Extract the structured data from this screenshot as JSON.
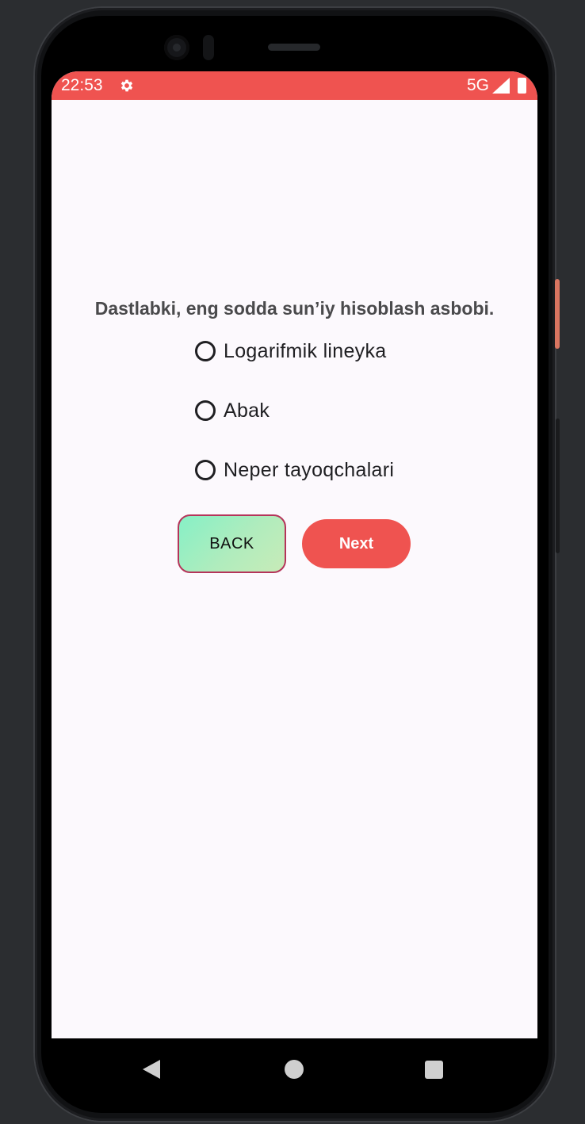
{
  "status_bar": {
    "time": "22:53",
    "network": "5G",
    "background_color": "#ef5350",
    "icons": [
      "gear-icon",
      "signal-icon",
      "battery-icon"
    ]
  },
  "quiz": {
    "question": "Dastlabki, eng sodda sun’iy hisoblash asbobi.",
    "options": [
      {
        "label": "Logarifmik lineyka",
        "selected": false
      },
      {
        "label": "Abak",
        "selected": false
      },
      {
        "label": "Neper tayoqchalari",
        "selected": false
      }
    ]
  },
  "buttons": {
    "back_label": "BACK",
    "next_label": "Next",
    "back_border_color": "#b5345a",
    "next_color": "#ef5350"
  },
  "nav_bar": {
    "icons": [
      "back-triangle-icon",
      "home-circle-icon",
      "recents-square-icon"
    ]
  }
}
